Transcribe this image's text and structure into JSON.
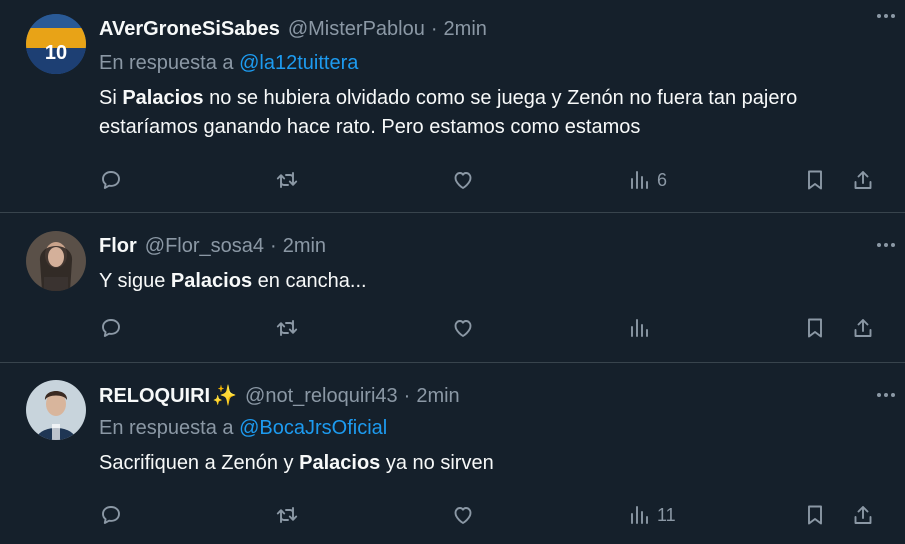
{
  "tweets": [
    {
      "name": "AVerGroneSiSabes",
      "handle": "@MisterPablou",
      "dot": "·",
      "time": "2min",
      "reply_prefix": "En respuesta a",
      "reply_to": "@la12tuittera",
      "text_pre": "Si ",
      "text_bold": "Palacios",
      "text_post": " no se hubiera olvidado como se juega y Zenón no fuera tan pajero estaríamos ganando hace rato. Pero estamos como estamos",
      "views": "6",
      "avatar_text": "10"
    },
    {
      "name": "Flor",
      "handle": "@Flor_sosa4",
      "dot": "·",
      "time": "2min",
      "text_pre": "Y sigue ",
      "text_bold": "Palacios",
      "text_post": " en cancha...",
      "views": ""
    },
    {
      "name": "RELOQUIRI",
      "name_emoji": "✨",
      "handle": "@not_reloquiri43",
      "dot": "·",
      "time": "2min",
      "reply_prefix": "En respuesta a",
      "reply_to": "@BocaJrsOficial",
      "text_pre": "Sacrifiquen a Zenón y ",
      "text_bold": "Palacios",
      "text_post": " ya no sirven",
      "views": "11"
    }
  ],
  "colors": {
    "background": "#15202b",
    "text": "#f7f9f9",
    "secondary": "#8b98a5",
    "link": "#1d9bf0",
    "divider": "#38444d"
  },
  "icons": [
    "reply-icon",
    "retweet-icon",
    "like-icon",
    "views-icon",
    "bookmark-icon",
    "share-icon",
    "more-icon"
  ]
}
